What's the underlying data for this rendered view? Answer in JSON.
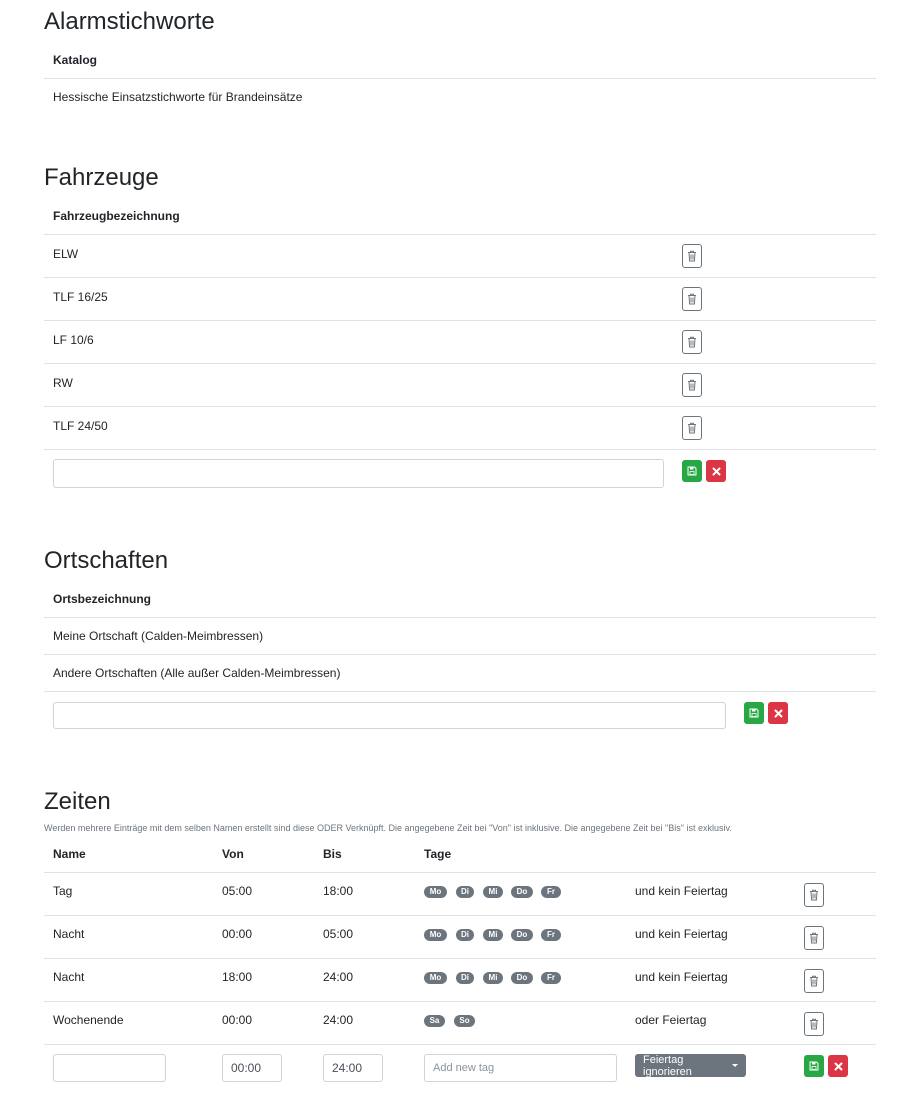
{
  "colors": {
    "success": "#28a745",
    "danger": "#dc3545",
    "secondary": "#6c757d",
    "border": "#dee2e6"
  },
  "icons": {
    "delete": "trash-icon",
    "save": "floppy-icon",
    "cancel": "close-icon"
  },
  "alarm": {
    "title": "Alarmstichworte",
    "header": "Katalog",
    "rows": [
      "Hessische Einsatzstichworte für Brandeinsätze"
    ]
  },
  "vehicles": {
    "title": "Fahrzeuge",
    "header": "Fahrzeugbezeichnung",
    "rows": [
      "ELW",
      "TLF 16/25",
      "LF 10/6",
      "RW",
      "TLF 24/50"
    ],
    "new_value": ""
  },
  "places": {
    "title": "Ortschaften",
    "header": "Ortsbezeichnung",
    "rows": [
      "Meine Ortschaft (Calden-Meimbressen)",
      "Andere Ortschaften (Alle außer Calden-Meimbressen)"
    ],
    "new_value": ""
  },
  "times": {
    "title": "Zeiten",
    "note": "Werden mehrere Einträge mit dem selben Namen erstellt sind diese ODER Verknüpft. Die angegebene Zeit bei \"Von\" ist inklusive. Die angegebene Zeit bei \"Bis\" ist exklusiv.",
    "headers": {
      "name": "Name",
      "from": "Von",
      "to": "Bis",
      "days": "Tage"
    },
    "rows": [
      {
        "name": "Tag",
        "from": "05:00",
        "to": "18:00",
        "days": [
          "Mo",
          "Di",
          "Mi",
          "Do",
          "Fr"
        ],
        "holiday": "und kein Feiertag"
      },
      {
        "name": "Nacht",
        "from": "00:00",
        "to": "05:00",
        "days": [
          "Mo",
          "Di",
          "Mi",
          "Do",
          "Fr"
        ],
        "holiday": "und kein Feiertag"
      },
      {
        "name": "Nacht",
        "from": "18:00",
        "to": "24:00",
        "days": [
          "Mo",
          "Di",
          "Mi",
          "Do",
          "Fr"
        ],
        "holiday": "und kein Feiertag"
      },
      {
        "name": "Wochenende",
        "from": "00:00",
        "to": "24:00",
        "days": [
          "Sa",
          "So"
        ],
        "holiday": "oder Feiertag"
      }
    ],
    "new_row": {
      "name": "",
      "from": "00:00",
      "to": "24:00",
      "tag_placeholder": "Add new tag",
      "holiday_dropdown": "Feiertag ignorieren"
    }
  }
}
